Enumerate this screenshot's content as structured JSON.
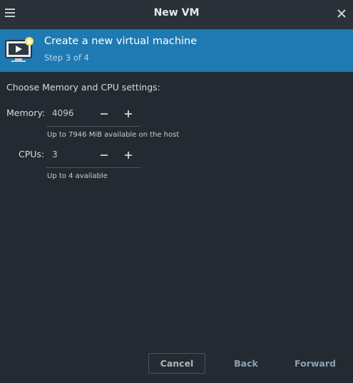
{
  "window": {
    "title": "New VM",
    "menu_icon": "hamburger-menu-icon",
    "close_icon": "close-icon"
  },
  "banner": {
    "title": "Create a new virtual machine",
    "step": "Step 3 of 4",
    "icon": "virtual-machine-icon"
  },
  "settings": {
    "heading": "Choose Memory and CPU settings:",
    "memory": {
      "label": "Memory:",
      "value": "4096",
      "hint": "Up to 7946 MiB available on the host"
    },
    "cpus": {
      "label": "CPUs:",
      "value": "3",
      "hint": "Up to 4 available"
    }
  },
  "footer": {
    "cancel": "Cancel",
    "back": "Back",
    "forward": "Forward"
  },
  "colors": {
    "background": "#232a31",
    "banner": "#1f7ab3",
    "accent_star": "#f5e663"
  }
}
